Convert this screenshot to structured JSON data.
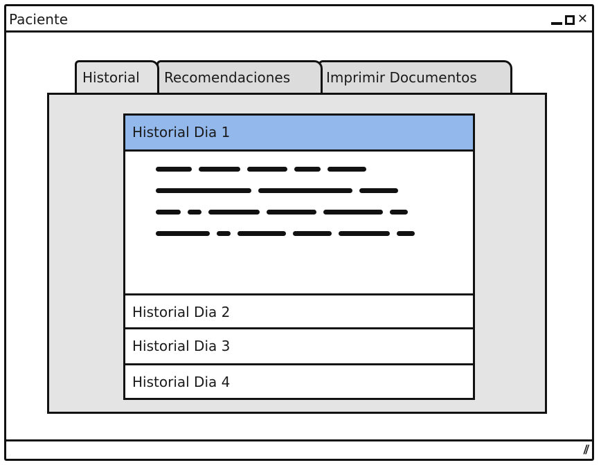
{
  "window": {
    "title": "Paciente",
    "controls": {
      "minimize": "minimize-icon",
      "maximize": "maximize-icon",
      "close": "close-icon"
    }
  },
  "tabs": [
    {
      "label": "Historial"
    },
    {
      "label": "Recomendaciones"
    },
    {
      "label": "Imprimir Documentos"
    }
  ],
  "accordion": {
    "items": [
      {
        "label": "Historial Dia 1"
      },
      {
        "label": "Historial Dia 2"
      },
      {
        "label": "Historial Dia 3"
      },
      {
        "label": "Historial Dia 4"
      }
    ]
  },
  "colors": {
    "active_header": "#93b8ec",
    "panel": "#e4e4e4",
    "tab": "#dcdcdc"
  }
}
